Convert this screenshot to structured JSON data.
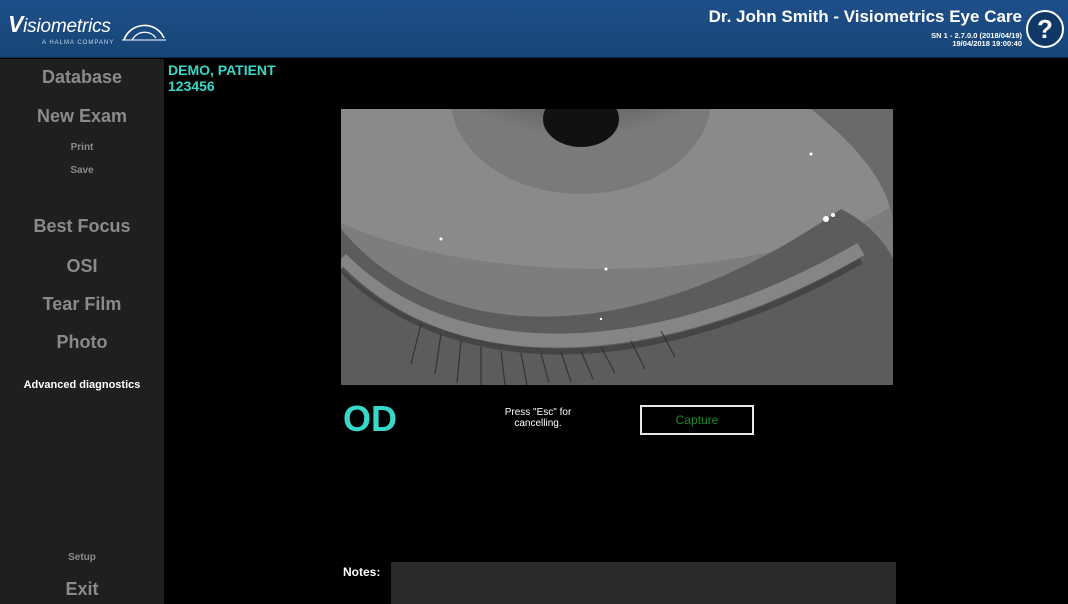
{
  "header": {
    "logo_text": "isiometrics",
    "logo_initial": "V",
    "logo_sub": "A HALMA COMPANY",
    "doctor": "Dr. John Smith - Visiometrics Eye Care",
    "sn_line1": "SN 1 - 2.7.0.0 (2018/04/19)",
    "sn_line2": "19/04/2018 19:00:40",
    "help_icon": "?"
  },
  "sidebar": {
    "database": "Database",
    "new_exam": "New Exam",
    "print": "Print",
    "save": "Save",
    "best_focus": "Best Focus",
    "osi": "OSI",
    "tear_film": "Tear Film",
    "photo": "Photo",
    "advanced": "Advanced diagnostics",
    "setup": "Setup",
    "exit": "Exit"
  },
  "patient": {
    "name": "DEMO, PATIENT",
    "id": "123456"
  },
  "main": {
    "eye_label": "OD",
    "esc_line1": "Press \"Esc\" for",
    "esc_line2": "cancelling.",
    "capture": "Capture",
    "notes_label": "Notes:",
    "notes_value": ""
  },
  "colors": {
    "header": "#1f4f8a",
    "accent": "#38d8c8",
    "capture_text": "#1e8c2a",
    "sidebar": "#1f1f1f"
  }
}
